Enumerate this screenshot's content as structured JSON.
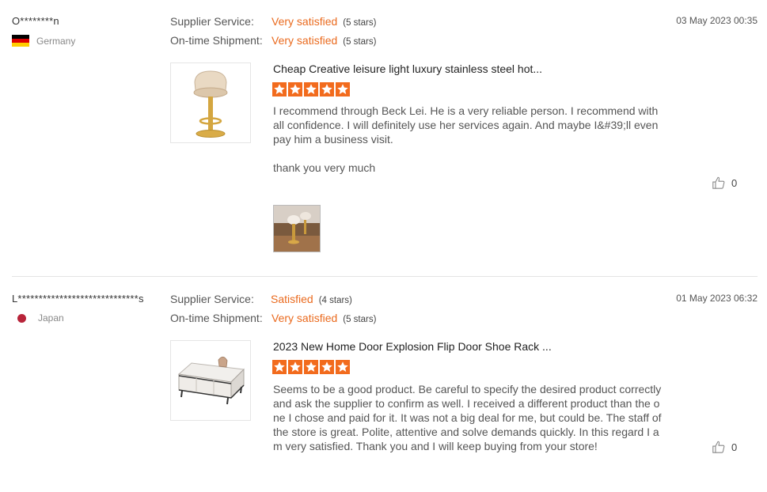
{
  "reviews": [
    {
      "user": "O********n",
      "country": "Germany",
      "supplier_service_label": "Supplier Service:",
      "supplier_service_value": "Very satisfied",
      "supplier_service_stars": "(5 stars)",
      "shipment_label": "On-time Shipment:",
      "shipment_value": "Very satisfied",
      "shipment_stars": "(5 stars)",
      "date": "03 May 2023 00:35",
      "product_title": "Cheap Creative leisure light luxury stainless steel hot...",
      "rating": 5,
      "text": "I recommend through Beck Lei. He is a very reliable person. I recommend with all confidence. I will definitely use her services again. And maybe I&#39;ll even pay him a business visit.",
      "text_extra": "thank you very much",
      "likes": "0",
      "product_icon": "bar-stool-image",
      "photo_icon": "customer-photo"
    },
    {
      "user": "L*****************************s",
      "country": "Japan",
      "supplier_service_label": "Supplier Service:",
      "supplier_service_value": "Satisfied",
      "supplier_service_stars": "(4 stars)",
      "shipment_label": "On-time Shipment:",
      "shipment_value": "Very satisfied",
      "shipment_stars": "(5 stars)",
      "date": "01 May 2023 06:32",
      "product_title": "2023 New Home Door Explosion Flip Door Shoe Rack ...",
      "rating": 5,
      "text": "Seems to be a good product.  Be careful to specify the desired product correctly and ask the supplier to confirm as well. I received a different product than the one I chose and paid for it. It was not a big deal for me, but could be. The staff of the store is great. Polite, attentive and solve demands quickly. In this regard I am very satisfied. Thank you and I will keep buying from your store!",
      "likes": "0",
      "product_icon": "shoe-cabinet-image"
    }
  ],
  "colors": {
    "accent": "#ea6a1e",
    "star": "#f26b1d",
    "divider": "#e3e3e3"
  }
}
